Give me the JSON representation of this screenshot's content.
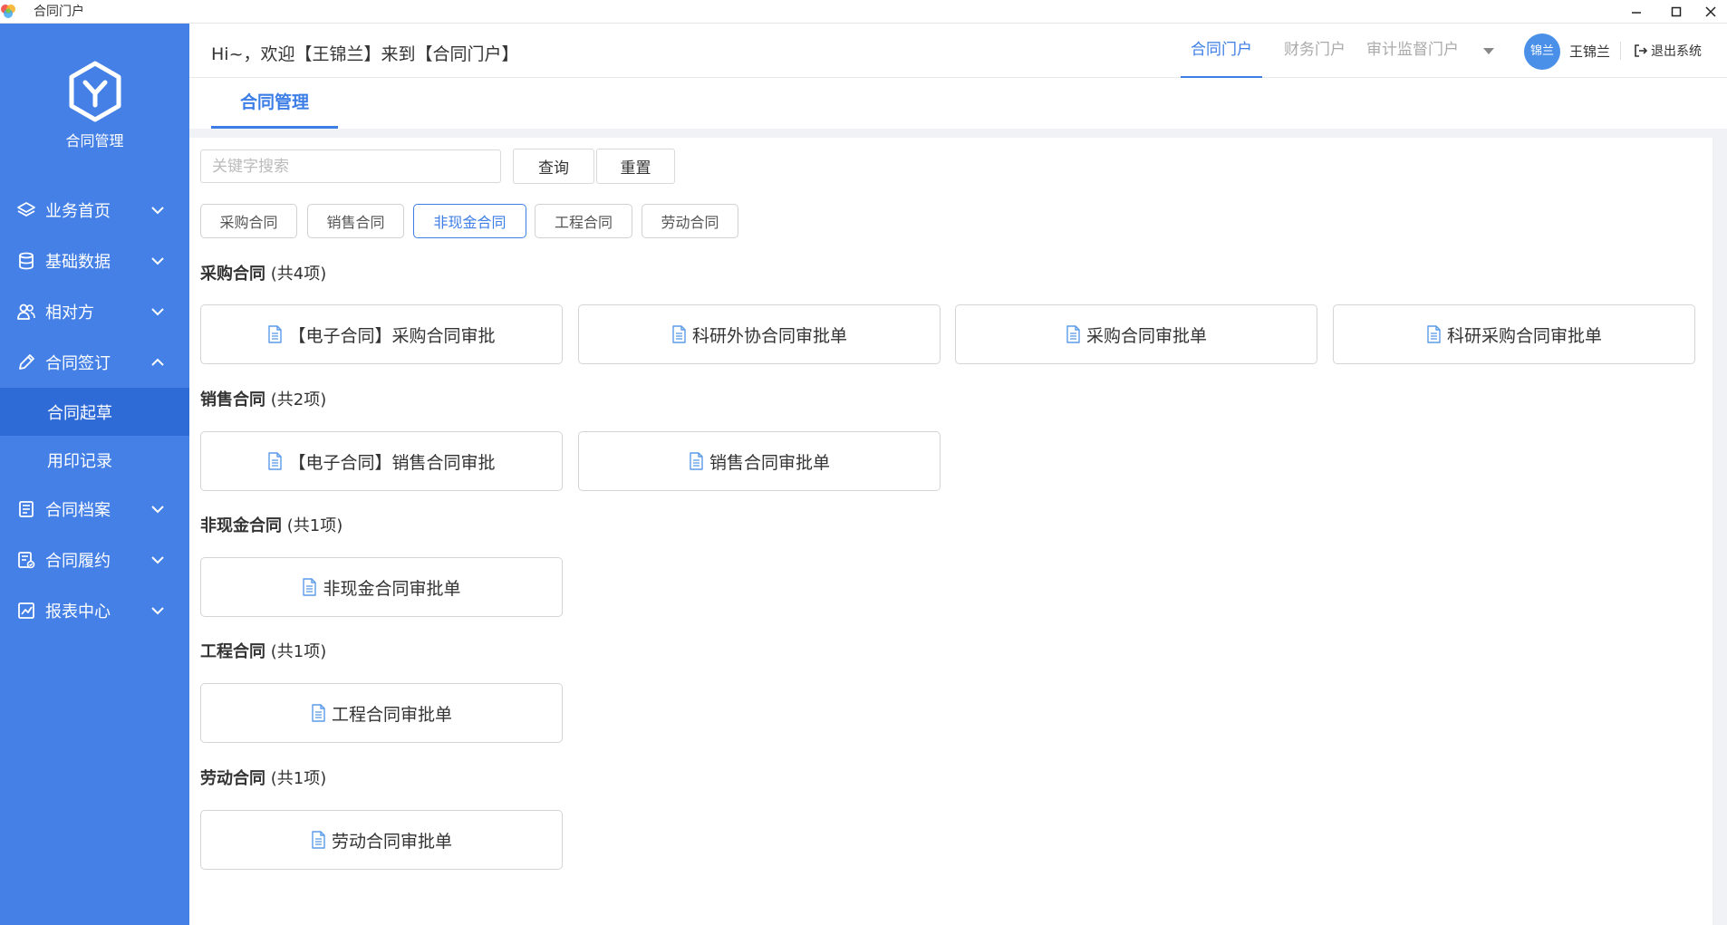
{
  "window": {
    "title": "合同门户",
    "logo_icon": "multicolor-app-logo-icon"
  },
  "sidebar": {
    "brand_name": "合同管理",
    "brand_icon": "cube-y-icon",
    "items": [
      {
        "label": "业务首页",
        "icon": "layers-icon",
        "expanded": false
      },
      {
        "label": "基础数据",
        "icon": "database-icon",
        "expanded": false
      },
      {
        "label": "相对方",
        "icon": "users-icon",
        "expanded": false
      },
      {
        "label": "合同签订",
        "icon": "pen-icon",
        "expanded": true,
        "children": [
          {
            "label": "合同起草",
            "active": true
          },
          {
            "label": "用印记录",
            "active": false
          }
        ]
      },
      {
        "label": "合同档案",
        "icon": "book-icon",
        "expanded": false
      },
      {
        "label": "合同履约",
        "icon": "checklist-icon",
        "expanded": false
      },
      {
        "label": "报表中心",
        "icon": "chart-icon",
        "expanded": false
      }
    ]
  },
  "header": {
    "welcome": "Hi~，欢迎【王锦兰】来到【合同门户】",
    "portals": [
      "合同门户",
      "财务门户",
      "审计监督门户"
    ],
    "active_portal": "合同门户",
    "avatar_text": "锦兰",
    "username": "王锦兰",
    "logout_label": "退出系统"
  },
  "page_tab": "合同管理",
  "search": {
    "placeholder": "关键字搜索",
    "value": "",
    "query_label": "查询",
    "reset_label": "重置"
  },
  "filters": {
    "items": [
      "采购合同",
      "销售合同",
      "非现金合同",
      "工程合同",
      "劳动合同"
    ],
    "active": "非现金合同"
  },
  "sections": [
    {
      "name": "采购合同",
      "count_text": "(共4项)",
      "cards": [
        "【电子合同】采购合同审批",
        "科研外协合同审批单",
        "采购合同审批单",
        "科研采购合同审批单"
      ]
    },
    {
      "name": "销售合同",
      "count_text": "(共2项)",
      "cards": [
        "【电子合同】销售合同审批",
        "销售合同审批单"
      ]
    },
    {
      "name": "非现金合同",
      "count_text": "(共1项)",
      "cards": [
        "非现金合同审批单"
      ]
    },
    {
      "name": "工程合同",
      "count_text": "(共1项)",
      "cards": [
        "工程合同审批单"
      ]
    },
    {
      "name": "劳动合同",
      "count_text": "(共1项)",
      "cards": [
        "劳动合同审批单"
      ]
    }
  ],
  "colors": {
    "sidebar_bg": "#4580e6",
    "sidebar_active": "#2f6bd6",
    "accent": "#3c7ee6",
    "doc_icon": "#5b9be8"
  }
}
